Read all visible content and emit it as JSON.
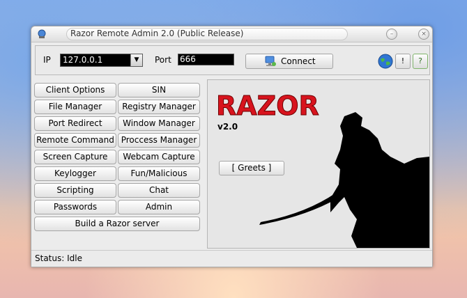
{
  "window": {
    "title": "Razor Remote Admin 2.0 (Public Release)"
  },
  "connection": {
    "ip_label": "IP",
    "ip_value": "127.0.0.1",
    "port_label": "Port",
    "port_value": "666",
    "connect_label": "Connect",
    "exclamation_label": "!",
    "help_label": "?"
  },
  "buttons": {
    "client_options": "Client Options",
    "sin": "SIN",
    "file_manager": "File Manager",
    "registry_manager": "Registry Manager",
    "port_redirect": "Port Redirect",
    "window_manager": "Window Manager",
    "remote_command": "Remote Command",
    "process_manager": "Proccess Manager",
    "screen_capture": "Screen Capture",
    "webcam_capture": "Webcam Capture",
    "keylogger": "Keylogger",
    "fun_malicious": "Fun/Malicious",
    "scripting": "Scripting",
    "chat": "Chat",
    "passwords": "Passwords",
    "admin": "Admin",
    "build_server": "Build a Razor server"
  },
  "panel": {
    "logo_text": "RAZOR",
    "version": "v2.0",
    "greets_label": "[  Greets  ]"
  },
  "status": {
    "text": "Status: Idle"
  },
  "colors": {
    "logo_red": "#d8141e",
    "field_bg": "#000000"
  }
}
